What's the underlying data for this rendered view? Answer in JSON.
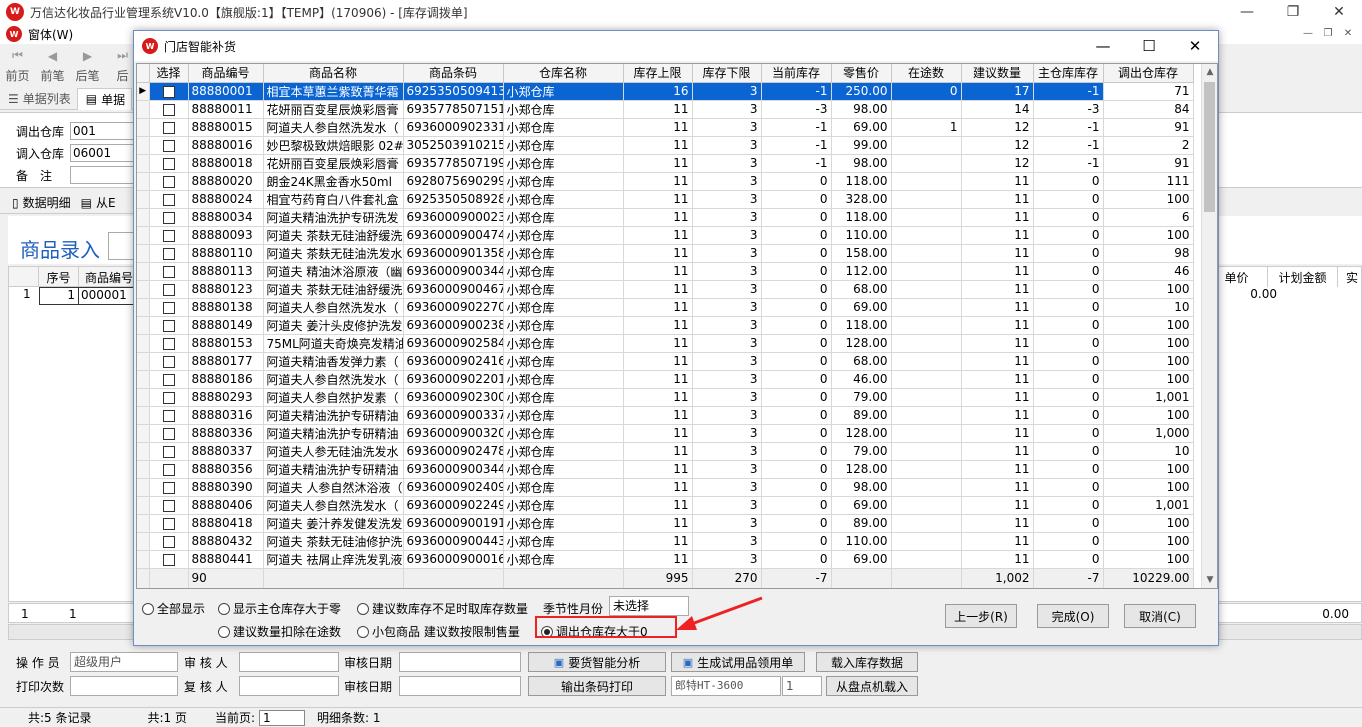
{
  "main": {
    "title": "万信达化妆品行业管理系统V10.0【旗舰版:1】【TEMP】(170906) - [库存调拨单]",
    "menu": "窗体(W)",
    "toolbar": [
      "前页",
      "前笔",
      "后笔",
      "后"
    ],
    "tabs": [
      "单据列表",
      "单据"
    ],
    "fields": {
      "out_label": "调出仓库",
      "out_value": "001",
      "in_label": "调入仓库",
      "in_value": "06001",
      "note_label": "备　注"
    },
    "subtabs": [
      "数据明细",
      "从E"
    ],
    "entry_label": "商品录入",
    "detail_head": [
      "序号",
      "商品编号"
    ],
    "detail_row": {
      "idx": "1",
      "seq": "1",
      "code": "000001"
    },
    "detail_right_head": [
      "单价",
      "计划金额",
      "实"
    ],
    "detail_right_value": "0.00",
    "detail_footer_left": "1",
    "detail_footer_seq": "1",
    "detail_footer_right": "0.00",
    "bottom": {
      "operator_label": "操 作 员",
      "operator_value": "超级用户",
      "auditor_label": "审 核 人",
      "audit_date_label": "审核日期",
      "print_count_label": "打印次数",
      "reviewer_label": "复 核 人",
      "review_date_label": "审核日期",
      "btn_analyze": "要货智能分析",
      "btn_generate": "生成试用品领用单",
      "btn_load": "载入库存数据",
      "btn_barcode": "输出条码打印",
      "printer": "郎特HT-3600",
      "copies": "1",
      "btn_inventory": "从盘点机载入"
    },
    "status": {
      "records": "共:5 条记录",
      "pages": "共:1 页",
      "current_label": "当前页:",
      "current_value": "1",
      "detail_count": "明细条数: 1"
    }
  },
  "dialog": {
    "title": "门店智能补货",
    "columns": [
      "选择",
      "商品编号",
      "商品名称",
      "商品条码",
      "仓库名称",
      "库存上限",
      "库存下限",
      "当前库存",
      "零售价",
      "在途数",
      "建议数量",
      "主仓库库存",
      "调出仓库存"
    ],
    "rows": [
      [
        "88880001",
        "相宜本草蕙兰紫致菁华霜",
        "6925350509413",
        "小郑仓库",
        "16",
        "3",
        "-1",
        "250.00",
        "0",
        "17",
        "-1",
        "71"
      ],
      [
        "88880011",
        "花妍丽百变星辰焕彩唇膏",
        "6935778507151",
        "小郑仓库",
        "11",
        "3",
        "-3",
        "98.00",
        "",
        "14",
        "-3",
        "84"
      ],
      [
        "88880015",
        "阿道夫人参自然洗发水（",
        "6936000902331",
        "小郑仓库",
        "11",
        "3",
        "-1",
        "69.00",
        "1",
        "12",
        "-1",
        "91"
      ],
      [
        "88880016",
        "妙巴黎极致烘焙眼影 02#",
        "3052503910215",
        "小郑仓库",
        "11",
        "3",
        "-1",
        "99.00",
        "",
        "12",
        "-1",
        "2"
      ],
      [
        "88880018",
        "花妍丽百变星辰焕彩唇膏",
        "6935778507199",
        "小郑仓库",
        "11",
        "3",
        "-1",
        "98.00",
        "",
        "12",
        "-1",
        "91"
      ],
      [
        "88880020",
        "朗金24K黑金香水50ml",
        "6928075690299",
        "小郑仓库",
        "11",
        "3",
        "0",
        "118.00",
        "",
        "11",
        "0",
        "111"
      ],
      [
        "88880024",
        "相宜芍药育白八件套礼盒",
        "6925350508928",
        "小郑仓库",
        "11",
        "3",
        "0",
        "328.00",
        "",
        "11",
        "0",
        "100"
      ],
      [
        "88880034",
        "阿道夫精油洗护专研洗发",
        "6936000900023",
        "小郑仓库",
        "11",
        "3",
        "0",
        "118.00",
        "",
        "11",
        "0",
        "6"
      ],
      [
        "88880093",
        "阿道夫 茶麸无硅油舒缓洗",
        "6936000900474",
        "小郑仓库",
        "11",
        "3",
        "0",
        "110.00",
        "",
        "11",
        "0",
        "100"
      ],
      [
        "88880110",
        "阿道夫 茶麸无硅油洗发水",
        "6936000901358",
        "小郑仓库",
        "11",
        "3",
        "0",
        "158.00",
        "",
        "11",
        "0",
        "98"
      ],
      [
        "88880113",
        "阿道夫 精油沐浴原液（幽",
        "6936000900344",
        "小郑仓库",
        "11",
        "3",
        "0",
        "112.00",
        "",
        "11",
        "0",
        "46"
      ],
      [
        "88880123",
        "阿道夫 茶麸无硅油舒缓洗",
        "6936000900467",
        "小郑仓库",
        "11",
        "3",
        "0",
        "68.00",
        "",
        "11",
        "0",
        "100"
      ],
      [
        "88880138",
        "阿道夫人参自然洗发水（",
        "6936000902270",
        "小郑仓库",
        "11",
        "3",
        "0",
        "69.00",
        "",
        "11",
        "0",
        "10"
      ],
      [
        "88880149",
        "阿道夫 姜汁头皮修护洗发",
        "6936000900238",
        "小郑仓库",
        "11",
        "3",
        "0",
        "118.00",
        "",
        "11",
        "0",
        "100"
      ],
      [
        "88880153",
        "75ML阿道夫奇焕亮发精油",
        "6936000902584",
        "小郑仓库",
        "11",
        "3",
        "0",
        "128.00",
        "",
        "11",
        "0",
        "100"
      ],
      [
        "88880177",
        "阿道夫精油香发弹力素（",
        "6936000902416",
        "小郑仓库",
        "11",
        "3",
        "0",
        "68.00",
        "",
        "11",
        "0",
        "100"
      ],
      [
        "88880186",
        "阿道夫人参自然洗发水（",
        "6936000902201",
        "小郑仓库",
        "11",
        "3",
        "0",
        "46.00",
        "",
        "11",
        "0",
        "100"
      ],
      [
        "88880293",
        "阿道夫人参自然护发素（",
        "6936000902300",
        "小郑仓库",
        "11",
        "3",
        "0",
        "79.00",
        "",
        "11",
        "0",
        "1,001"
      ],
      [
        "88880316",
        "阿道夫精油洗护专研精油",
        "6936000900337",
        "小郑仓库",
        "11",
        "3",
        "0",
        "89.00",
        "",
        "11",
        "0",
        "100"
      ],
      [
        "88880336",
        "阿道夫精油洗护专研精油",
        "6936000900320",
        "小郑仓库",
        "11",
        "3",
        "0",
        "128.00",
        "",
        "11",
        "0",
        "1,000"
      ],
      [
        "88880337",
        "阿道夫人参无硅油洗发水",
        "6936000902478",
        "小郑仓库",
        "11",
        "3",
        "0",
        "79.00",
        "",
        "11",
        "0",
        "10"
      ],
      [
        "88880356",
        "阿道夫精油洗护专研精油",
        "6936000900344",
        "小郑仓库",
        "11",
        "3",
        "0",
        "128.00",
        "",
        "11",
        "0",
        "100"
      ],
      [
        "88880390",
        "阿道夫 人参自然沐浴液（",
        "6936000902409",
        "小郑仓库",
        "11",
        "3",
        "0",
        "98.00",
        "",
        "11",
        "0",
        "100"
      ],
      [
        "88880406",
        "阿道夫人参自然洗发水（",
        "6936000902249",
        "小郑仓库",
        "11",
        "3",
        "0",
        "69.00",
        "",
        "11",
        "0",
        "1,001"
      ],
      [
        "88880418",
        "阿道夫 姜汁养发健发洗发",
        "6936000900191",
        "小郑仓库",
        "11",
        "3",
        "0",
        "89.00",
        "",
        "11",
        "0",
        "100"
      ],
      [
        "88880432",
        "阿道夫 茶麸无硅油修护洗",
        "6936000900443",
        "小郑仓库",
        "11",
        "3",
        "0",
        "110.00",
        "",
        "11",
        "0",
        "100"
      ],
      [
        "88880441",
        "阿道夫 祛屑止痒洗发乳液",
        "6936000900016",
        "小郑仓库",
        "11",
        "3",
        "0",
        "69.00",
        "",
        "11",
        "0",
        "100"
      ]
    ],
    "totals": {
      "count": "90",
      "upper": "995",
      "lower": "270",
      "current": "-7",
      "suggest": "1,002",
      "main_stock": "-7",
      "out_stock": "10229.00"
    },
    "options": {
      "all": "全部显示",
      "main_gt_zero": "显示主仓库存大于零",
      "suggest_insufficient": "建议数库存不足时取库存数量",
      "season_label": "季节性月份",
      "season_value": "未选择",
      "deduct_transit": "建议数量扣除在途数",
      "small_pack": "小包商品 建议数按限制售量",
      "out_gt_zero": "调出仓库存大于0"
    },
    "buttons": {
      "prev": "上一步(R)",
      "finish": "完成(O)",
      "cancel": "取消(C)"
    }
  }
}
